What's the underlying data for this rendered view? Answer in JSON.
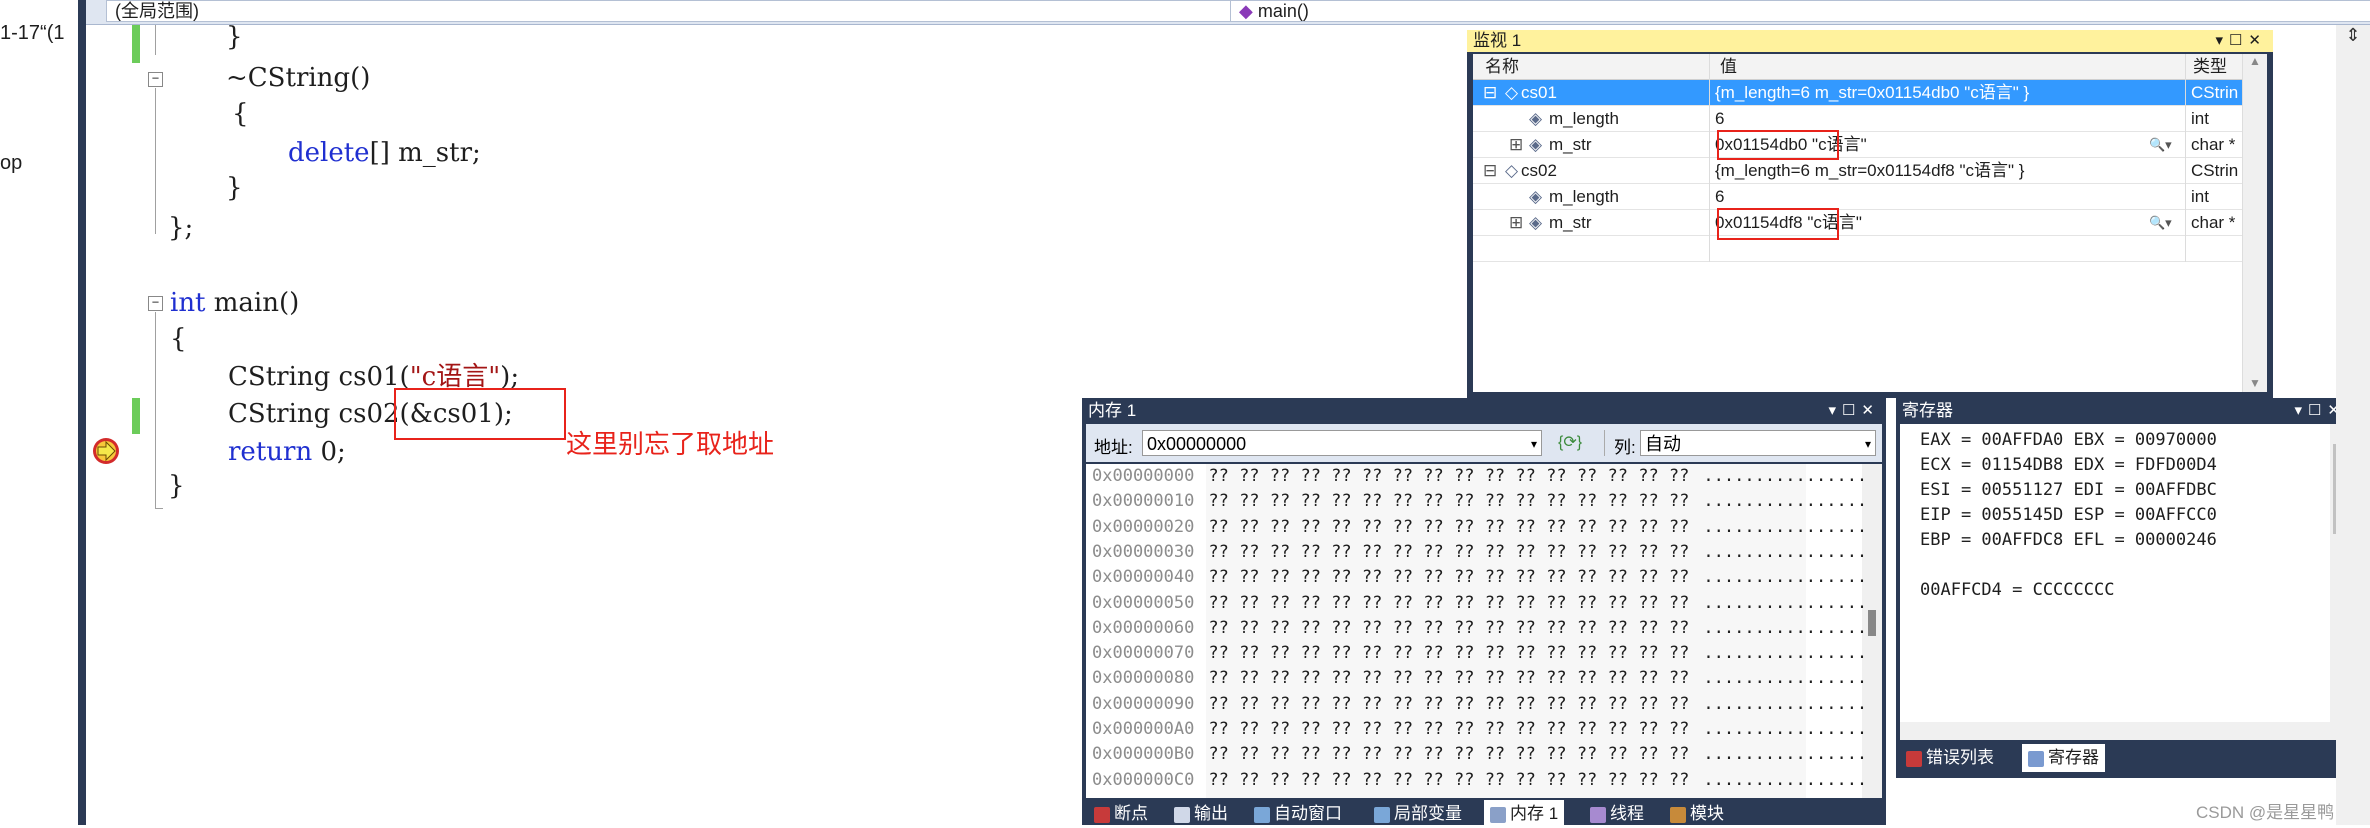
{
  "leftstrip": {
    "line1": "1-17“(1",
    "line2": "op"
  },
  "nav": {
    "scope": "(全局范围)",
    "member": "main()"
  },
  "code": {
    "l1": "}",
    "l2": "~CString()",
    "l3": "{",
    "l4_kw": "delete",
    "l4_rest": "[] m_str;",
    "l5": "}",
    "l6": "};",
    "l7_kw": "int",
    "l7_rest": " main()",
    "l8": "{",
    "l9_pre": "CString cs01(",
    "l9_str": "\"c语言\"",
    "l9_post": ");",
    "l10": "CString cs02(&cs01);",
    "l11_kw": "return",
    "l11_rest": " 0;",
    "l12": "}"
  },
  "annotation": "这里别忘了取地址",
  "watch": {
    "title": "监视 1",
    "headers": {
      "name": "名称",
      "value": "值",
      "type": "类型"
    },
    "rows": [
      {
        "name": "cs01",
        "value": "{m_length=6 m_str=0x01154db0 \"c语言\" }",
        "type": "CStrin"
      },
      {
        "name": "m_length",
        "value": "6",
        "type": "int"
      },
      {
        "name": "m_str",
        "value": "0x01154db0 \"c语言\"",
        "type": "char *"
      },
      {
        "name": "cs02",
        "value": "{m_length=6 m_str=0x01154df8 \"c语言\" }",
        "type": "CStrin"
      },
      {
        "name": "m_length",
        "value": "6",
        "type": "int"
      },
      {
        "name": "m_str",
        "value": "0x01154df8 \"c语言\"",
        "type": "char *"
      }
    ]
  },
  "memory": {
    "title": "内存 1",
    "addr_label": "地址:",
    "addr_value": "0x00000000",
    "col_label": "列:",
    "col_value": "自动",
    "rows": [
      {
        "addr": "0x00000000",
        "hex": "?? ?? ?? ?? ?? ?? ?? ?? ?? ?? ?? ?? ?? ?? ?? ??",
        "ascii": "................"
      },
      {
        "addr": "0x00000010",
        "hex": "?? ?? ?? ?? ?? ?? ?? ?? ?? ?? ?? ?? ?? ?? ?? ??",
        "ascii": "................"
      },
      {
        "addr": "0x00000020",
        "hex": "?? ?? ?? ?? ?? ?? ?? ?? ?? ?? ?? ?? ?? ?? ?? ??",
        "ascii": "................"
      },
      {
        "addr": "0x00000030",
        "hex": "?? ?? ?? ?? ?? ?? ?? ?? ?? ?? ?? ?? ?? ?? ?? ??",
        "ascii": "................"
      },
      {
        "addr": "0x00000040",
        "hex": "?? ?? ?? ?? ?? ?? ?? ?? ?? ?? ?? ?? ?? ?? ?? ??",
        "ascii": "................"
      },
      {
        "addr": "0x00000050",
        "hex": "?? ?? ?? ?? ?? ?? ?? ?? ?? ?? ?? ?? ?? ?? ?? ??",
        "ascii": "................"
      },
      {
        "addr": "0x00000060",
        "hex": "?? ?? ?? ?? ?? ?? ?? ?? ?? ?? ?? ?? ?? ?? ?? ??",
        "ascii": "................"
      },
      {
        "addr": "0x00000070",
        "hex": "?? ?? ?? ?? ?? ?? ?? ?? ?? ?? ?? ?? ?? ?? ?? ??",
        "ascii": "................"
      },
      {
        "addr": "0x00000080",
        "hex": "?? ?? ?? ?? ?? ?? ?? ?? ?? ?? ?? ?? ?? ?? ?? ??",
        "ascii": "................"
      },
      {
        "addr": "0x00000090",
        "hex": "?? ?? ?? ?? ?? ?? ?? ?? ?? ?? ?? ?? ?? ?? ?? ??",
        "ascii": "................"
      },
      {
        "addr": "0x000000A0",
        "hex": "?? ?? ?? ?? ?? ?? ?? ?? ?? ?? ?? ?? ?? ?? ?? ??",
        "ascii": "................"
      },
      {
        "addr": "0x000000B0",
        "hex": "?? ?? ?? ?? ?? ?? ?? ?? ?? ?? ?? ?? ?? ?? ?? ??",
        "ascii": "................"
      },
      {
        "addr": "0x000000C0",
        "hex": "?? ?? ?? ?? ?? ?? ?? ?? ?? ?? ?? ?? ?? ?? ?? ??",
        "ascii": "................"
      }
    ]
  },
  "bottom_tabs": [
    "断点",
    "输出",
    "自动窗口",
    "局部变量",
    "内存 1",
    "线程",
    "模块"
  ],
  "registers": {
    "title": "寄存器",
    "lines": [
      "EAX = 00AFFDA0 EBX = 00970000",
      "ECX = 01154DB8 EDX = FDFD00D4",
      "ESI = 00551127 EDI = 00AFFDBC",
      "EIP = 0055145D ESP = 00AFFCC0",
      "EBP = 00AFFDC8 EFL = 00000246",
      "",
      "00AFFCD4 = CCCCCCCC"
    ],
    "tabs": [
      "错误列表",
      "寄存器"
    ]
  },
  "watermark": "CSDN @是星星鸭",
  "colors": {
    "panel_bg": "#2b3a55",
    "active_title": "#fff29d",
    "keyword": "#1f2fd0",
    "string": "#a31515",
    "annotation": "#e8231b",
    "change_bar": "#6ccc5a",
    "selection": "#3399ff"
  }
}
